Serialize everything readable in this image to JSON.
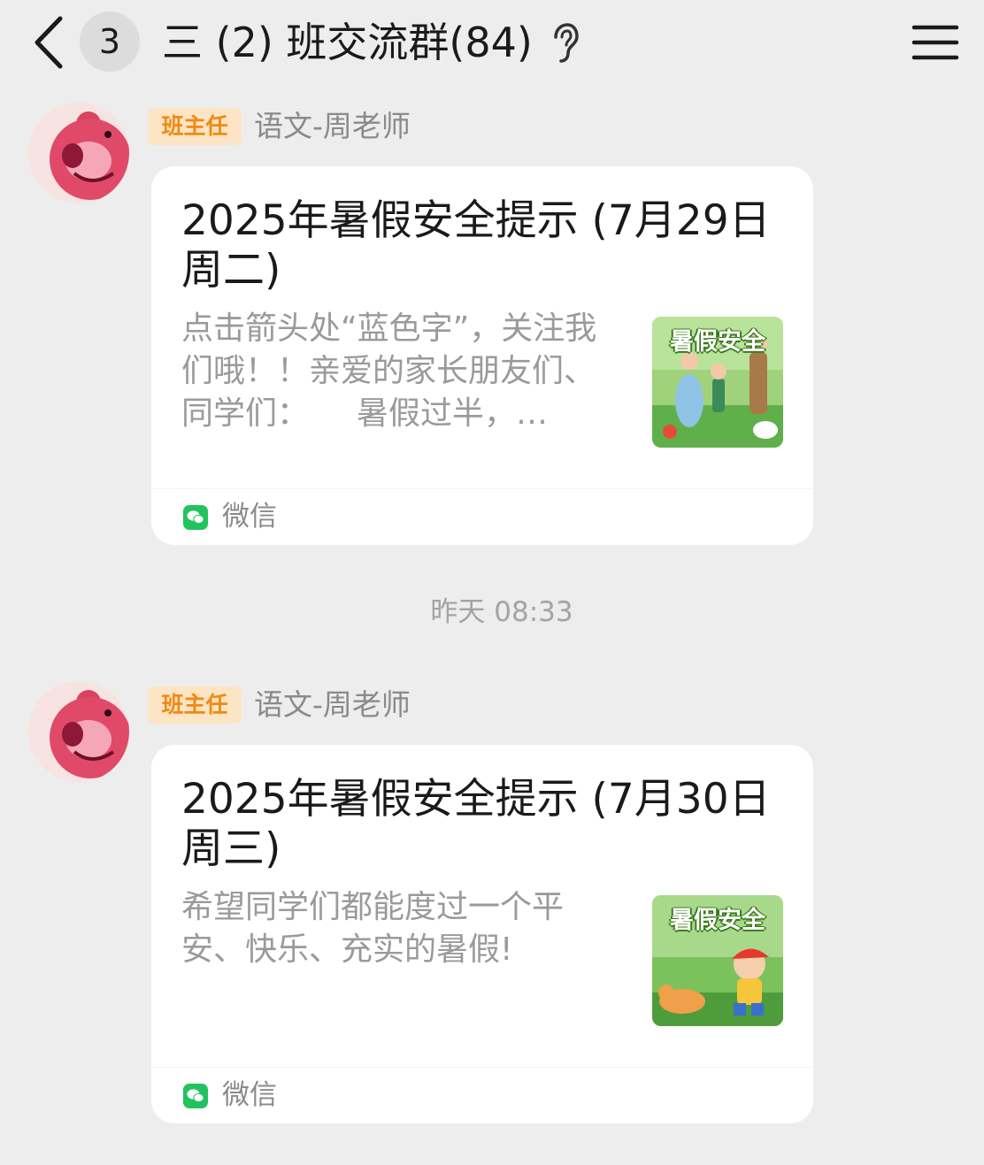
{
  "header": {
    "back_icon": "chevron-left-icon",
    "unread_count": "3",
    "title": "三 (2) 班交流群(84)",
    "earpiece_icon": "ear-icon",
    "menu_icon": "hamburger-menu-icon"
  },
  "messages": [
    {
      "avatar_icon": "pink-bear-avatar",
      "role_badge": "班主任",
      "sender": "语文-周老师",
      "card": {
        "title": "2025年暑假安全提示 (7月29日周二)",
        "description": "点击箭头处“蓝色字”，关注我们哦！！亲爱的家长朋友们、同学们：　　暑假过半，…",
        "thumbnail_text": "暑假安全",
        "source_icon": "wechat-icon",
        "source": "微信"
      }
    },
    {
      "avatar_icon": "pink-bear-avatar",
      "role_badge": "班主任",
      "sender": "语文-周老师",
      "card": {
        "title": "2025年暑假安全提示 (7月30日周三)",
        "description": "希望同学们都能度过一个平安、快乐、充实的暑假!",
        "thumbnail_text": "暑假安全",
        "source_icon": "wechat-icon",
        "source": "微信"
      }
    }
  ],
  "timestamp": "昨天 08:33",
  "colors": {
    "background": "#ededed",
    "card": "#ffffff",
    "role_badge_bg": "#fde4c4",
    "role_badge_text": "#f08a10",
    "wechat_green": "#22c35e"
  }
}
